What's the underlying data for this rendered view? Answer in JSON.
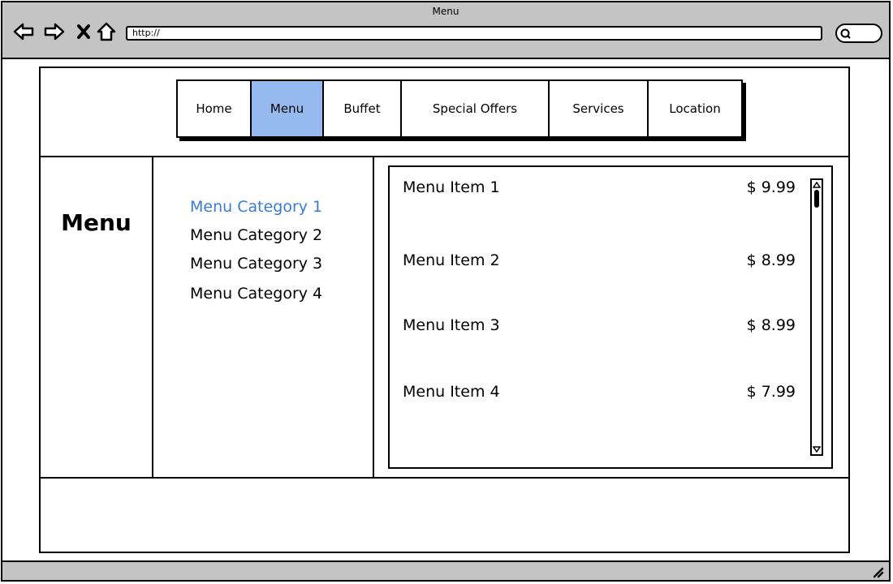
{
  "window": {
    "title": "Menu"
  },
  "browser": {
    "url": "http://"
  },
  "nav": {
    "tabs": [
      {
        "label": "Home",
        "active": false
      },
      {
        "label": "Menu",
        "active": true
      },
      {
        "label": "Buffet",
        "active": false
      },
      {
        "label": "Special Offers",
        "active": false
      },
      {
        "label": "Services",
        "active": false
      },
      {
        "label": "Location",
        "active": false
      }
    ]
  },
  "section": {
    "title": "Menu"
  },
  "categories": [
    {
      "label": "Menu Category 1",
      "active": true
    },
    {
      "label": "Menu Category 2",
      "active": false
    },
    {
      "label": "Menu Category 3",
      "active": false
    },
    {
      "label": "Menu Category 4",
      "active": false
    }
  ],
  "items": [
    {
      "name": "Menu Item 1",
      "price": "$ 9.99"
    },
    {
      "name": "Menu Item 2",
      "price": "$ 8.99"
    },
    {
      "name": "Menu Item 3",
      "price": "$ 8.99"
    },
    {
      "name": "Menu Item 4",
      "price": "$ 7.99"
    }
  ],
  "colors": {
    "active_tab": "#96b9f0",
    "active_link": "#3a7bd5",
    "chrome": "#c4c4c4"
  },
  "icons": [
    "back-icon",
    "forward-icon",
    "close-icon",
    "home-icon",
    "search-icon",
    "resize-grip-icon"
  ]
}
